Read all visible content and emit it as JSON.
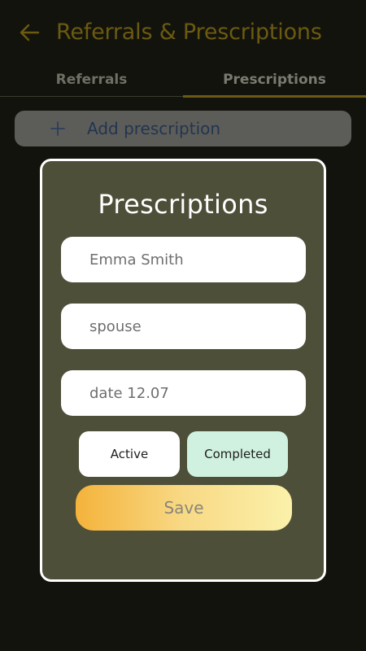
{
  "app_bar": {
    "title": "Referrals & Prescriptions",
    "back_icon": "arrow-left-icon"
  },
  "tabs": [
    {
      "label": "Referrals",
      "selected": false
    },
    {
      "label": "Prescriptions",
      "selected": true
    }
  ],
  "add_button": {
    "label": "Add prescription",
    "icon": "plus-icon"
  },
  "dialog": {
    "title": "Prescriptions",
    "fields": {
      "name": "Emma Smith",
      "relation": "spouse",
      "date": "date 12.07"
    },
    "status_options": [
      "Active",
      "Completed"
    ],
    "selected_status": "Completed",
    "save_label": "Save"
  },
  "colors": {
    "background": "#12130c",
    "title_accent": "#6b5a12",
    "dialog_background": "#4e4f39",
    "completed_highlight": "#d0f1e0",
    "save_gradient_start": "#f4b33b",
    "save_gradient_end": "#fbf1aa"
  }
}
